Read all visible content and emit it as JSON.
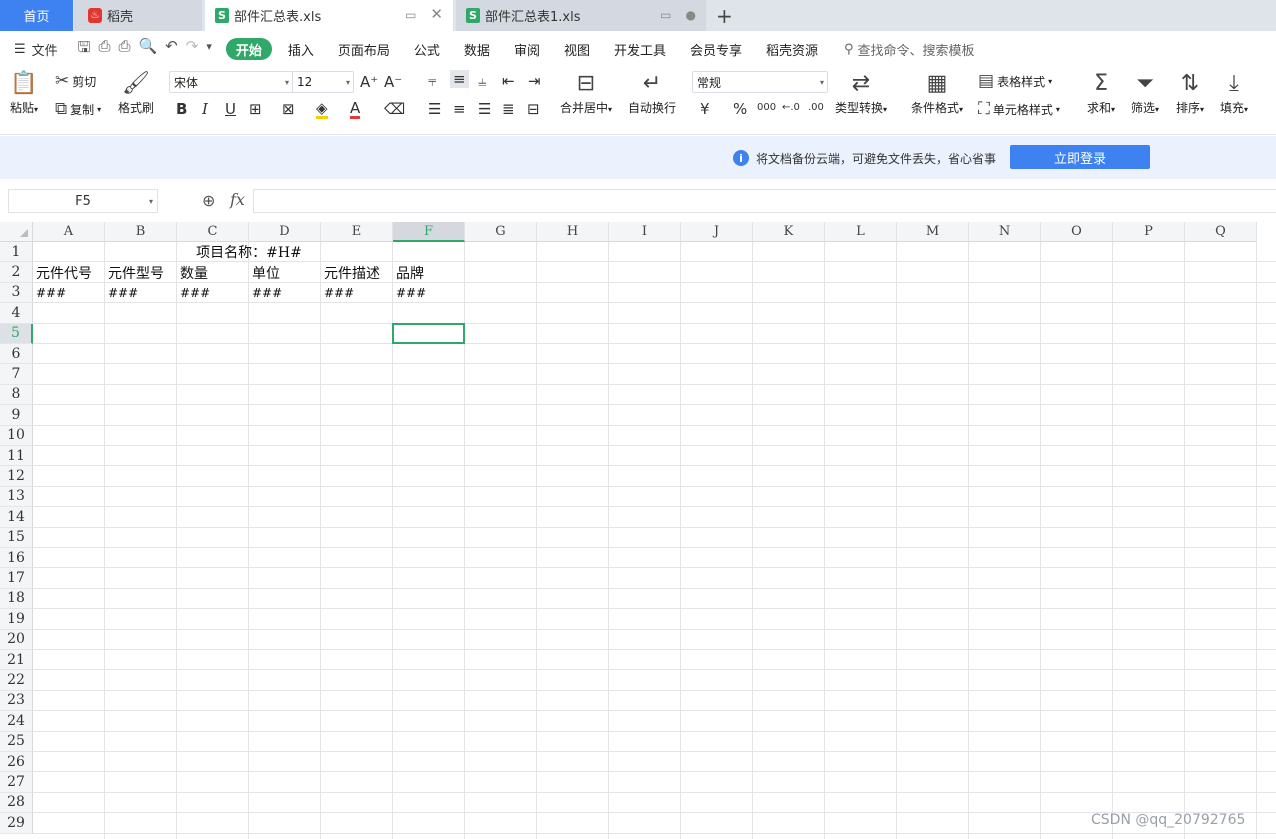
{
  "tabs": {
    "home": "首页",
    "daoke": "稻壳",
    "file1": "部件汇总表.xls",
    "file2": "部件汇总表1.xls"
  },
  "menu": {
    "file": "文件",
    "tabs": [
      "开始",
      "插入",
      "页面布局",
      "公式",
      "数据",
      "审阅",
      "视图",
      "开发工具",
      "会员专享",
      "稻壳资源"
    ],
    "search": "查找命令、搜索模板"
  },
  "ribbon": {
    "paste": "粘贴",
    "cut": "剪切",
    "copy": "复制",
    "format_painter": "格式刷",
    "font_name": "宋体",
    "font_size": "12",
    "merge_center": "合并居中",
    "wrap_text": "自动换行",
    "number_format": "常规",
    "type_convert": "类型转换",
    "conditional_format": "条件格式",
    "table_style": "表格样式",
    "cell_style": "单元格样式",
    "sum": "求和",
    "filter": "筛选",
    "sort": "排序",
    "fill": "填充"
  },
  "notice": {
    "message": "将文档备份云端，可避免文件丢失，省心省事",
    "login": "立即登录"
  },
  "formula_bar": {
    "name_box": "F5",
    "fx": "fx",
    "formula": ""
  },
  "sheet": {
    "columns": [
      "A",
      "B",
      "C",
      "D",
      "E",
      "F",
      "G",
      "H",
      "I",
      "J",
      "K",
      "L",
      "M",
      "N",
      "O",
      "P",
      "Q"
    ],
    "rows": [
      "1",
      "2",
      "3",
      "4",
      "5",
      "6",
      "7",
      "8",
      "9",
      "10",
      "11",
      "12",
      "13",
      "14",
      "15",
      "16",
      "17",
      "18",
      "19",
      "20",
      "21",
      "22",
      "23",
      "24",
      "25",
      "26",
      "27",
      "28",
      "29"
    ],
    "title": "项目名称：#H#",
    "headers": [
      "元件代号",
      "元件型号",
      "数量",
      "单位",
      "元件描述",
      "品牌"
    ],
    "row3": [
      "###",
      "###",
      "###",
      "###",
      "###",
      "###"
    ],
    "active_cell": "F5"
  },
  "watermark": "CSDN @qq_20792765"
}
